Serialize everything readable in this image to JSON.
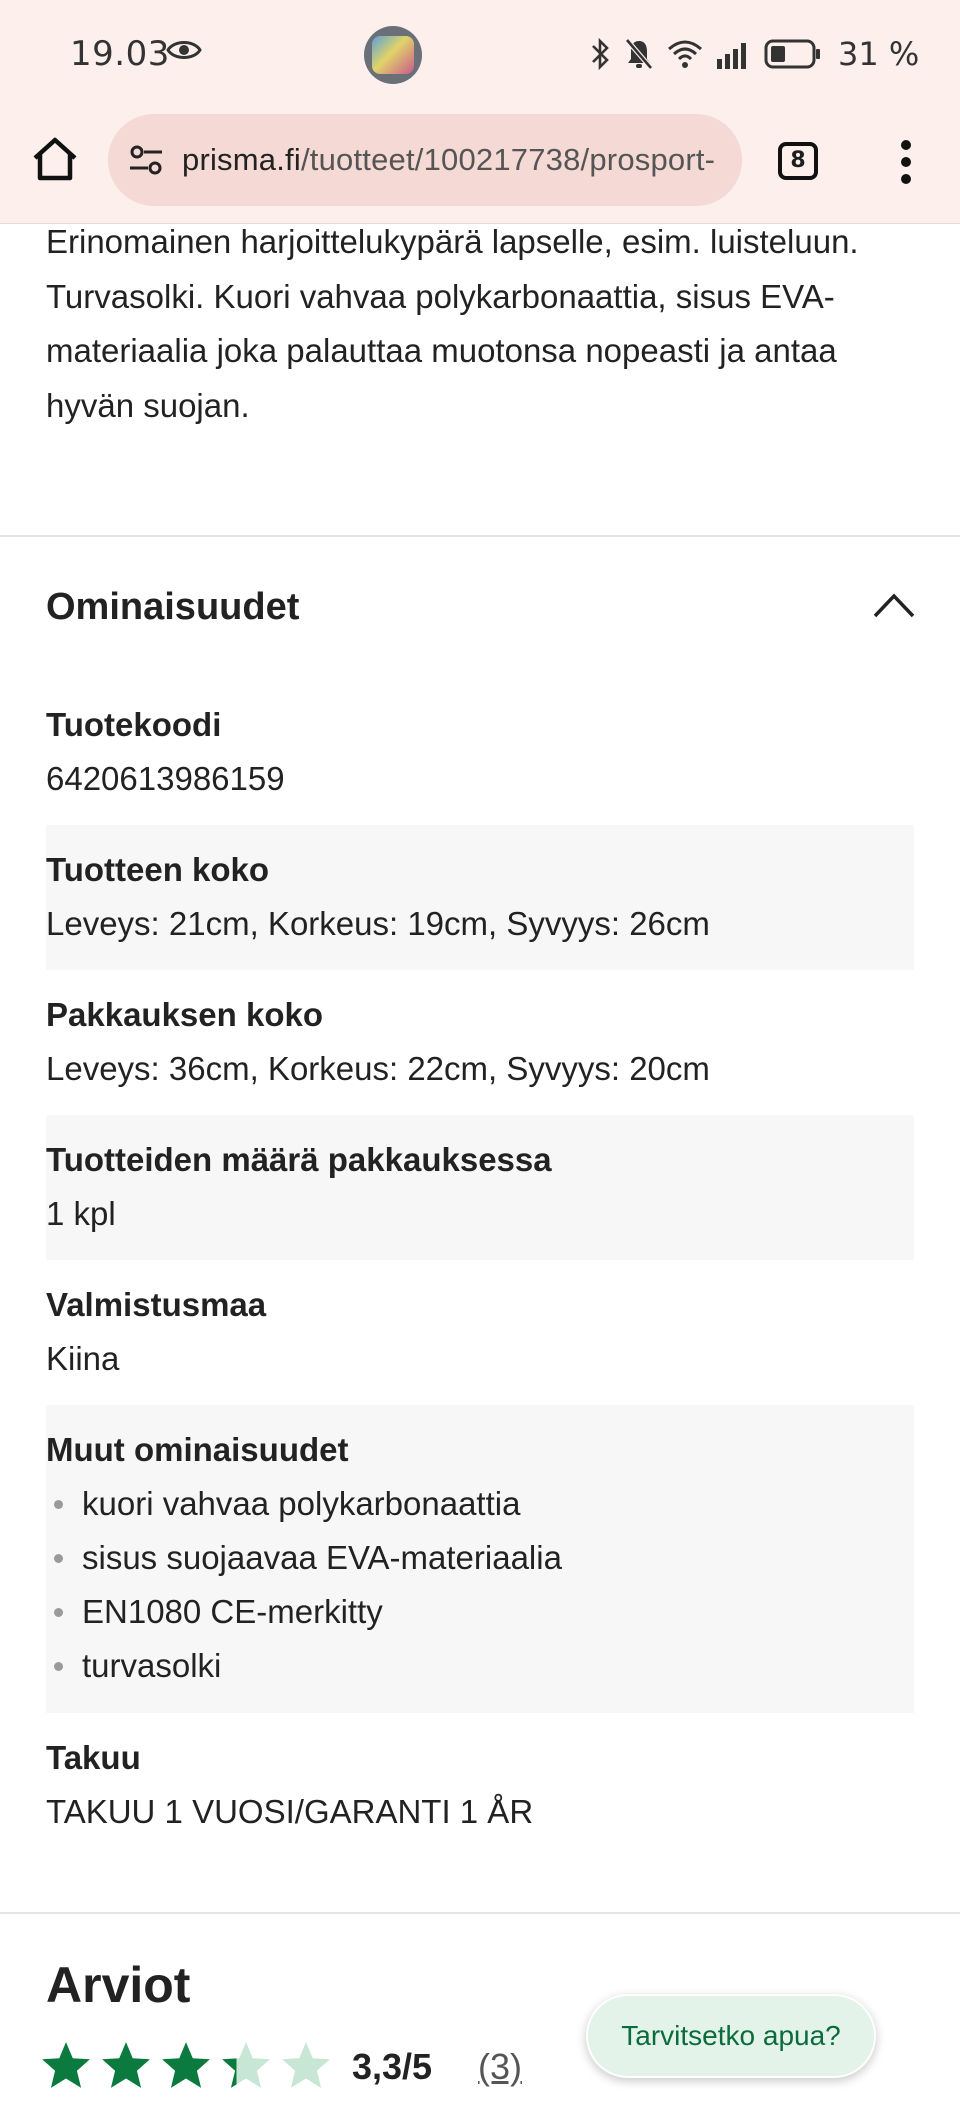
{
  "status_bar": {
    "time": "19.03",
    "battery_text": "31 %",
    "icons": [
      "eye-icon",
      "bluetooth-icon",
      "bell-off-icon",
      "wifi-icon",
      "signal-icon",
      "battery-icon"
    ]
  },
  "browser": {
    "url_domain": "prisma.fi",
    "url_path": "/tuotteet/100217738/prosport-",
    "tab_count": "8",
    "icons": [
      "home-icon",
      "tune-icon",
      "more-vertical-icon"
    ]
  },
  "product": {
    "description": "Erinomainen harjoittelukypärä lapselle, esim. luisteluun. Turvasolki. Kuori vahvaa polykarbonaattia, sisus EVA-materiaalia joka palauttaa muotonsa nopeasti ja antaa hyvän suojan."
  },
  "properties": {
    "title": "Ominaisuudet",
    "items": [
      {
        "label": "Tuotekoodi",
        "value": "6420613986159"
      },
      {
        "label": "Tuotteen koko",
        "value": "Leveys: 21cm, Korkeus: 19cm, Syvyys: 26cm"
      },
      {
        "label": "Pakkauksen koko",
        "value": "Leveys: 36cm, Korkeus: 22cm, Syvyys: 20cm"
      },
      {
        "label": "Tuotteiden määrä pakkauksessa",
        "value": "1 kpl"
      },
      {
        "label": "Valmistusmaa",
        "value": "Kiina"
      },
      {
        "label": "Muut ominaisuudet",
        "bullets": [
          "kuori vahvaa polykarbonaattia",
          "sisus suojaavaa EVA-materiaalia",
          "EN1080 CE-merkitty",
          "turvasolki"
        ]
      },
      {
        "label": "Takuu",
        "value": "TAKUU 1 VUOSI/GARANTI 1 ÅR"
      }
    ]
  },
  "reviews": {
    "title": "Arviot",
    "rating": 3.3,
    "rating_max": 5,
    "rating_text": "3,3/5",
    "count_text": "(3)",
    "star_color": "#0b7a3e",
    "star_empty_color": "#c8e6d4"
  },
  "help": {
    "label": "Tarvitsetko apua?"
  }
}
